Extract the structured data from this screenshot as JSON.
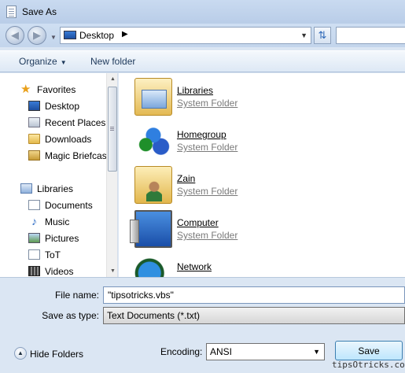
{
  "window": {
    "title": "Save As"
  },
  "address": {
    "path": "Desktop"
  },
  "toolbar": {
    "organize_label": "Organize",
    "new_folder_label": "New folder"
  },
  "nav": {
    "favorites": {
      "label": "Favorites",
      "icon": "star-icon"
    },
    "favorite_items": [
      {
        "label": "Desktop",
        "icon": "desktop-icon"
      },
      {
        "label": "Recent Places",
        "icon": "recent-places-icon"
      },
      {
        "label": "Downloads",
        "icon": "folder-icon"
      },
      {
        "label": "Magic Briefcase",
        "icon": "briefcase-icon"
      }
    ],
    "libraries": {
      "label": "Libraries",
      "icon": "libraries-icon"
    },
    "library_items": [
      {
        "label": "Documents",
        "icon": "documents-icon"
      },
      {
        "label": "Music",
        "icon": "music-icon"
      },
      {
        "label": "Pictures",
        "icon": "pictures-icon"
      },
      {
        "label": "ToT",
        "icon": "document-icon"
      },
      {
        "label": "Videos",
        "icon": "videos-icon"
      }
    ]
  },
  "content": {
    "items": [
      {
        "name": "Libraries",
        "type": "System Folder",
        "icon": "libraries-folder-icon"
      },
      {
        "name": "Homegroup",
        "type": "System Folder",
        "icon": "homegroup-icon"
      },
      {
        "name": "Zain",
        "type": "System Folder",
        "icon": "user-folder-icon"
      },
      {
        "name": "Computer",
        "type": "System Folder",
        "icon": "computer-icon"
      },
      {
        "name": "Network",
        "type": "",
        "icon": "network-icon"
      }
    ]
  },
  "form": {
    "file_name_label": "File name:",
    "file_name_value": "\"tipsotricks.vbs\"",
    "save_type_label": "Save as type:",
    "save_type_value": "Text Documents (*.txt)",
    "hide_folders_label": "Hide Folders",
    "encoding_label": "Encoding:",
    "encoding_value": "ANSI",
    "save_label": "Save"
  },
  "watermark": "tipsOtricks.com"
}
